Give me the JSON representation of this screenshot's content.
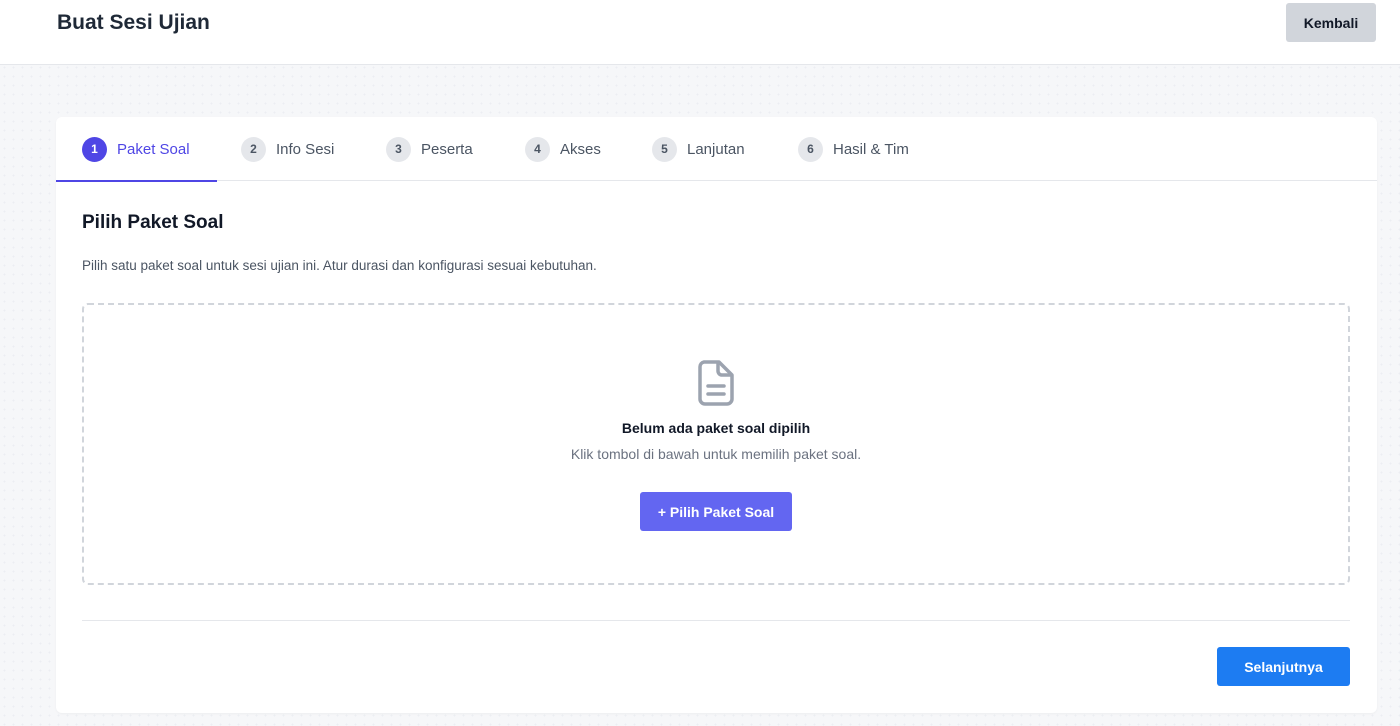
{
  "header": {
    "title": "Buat Sesi Ujian",
    "back_label": "Kembali"
  },
  "tabs": [
    {
      "number": "1",
      "label": "Paket Soal",
      "active": true
    },
    {
      "number": "2",
      "label": "Info Sesi",
      "active": false
    },
    {
      "number": "3",
      "label": "Peserta",
      "active": false
    },
    {
      "number": "4",
      "label": "Akses",
      "active": false
    },
    {
      "number": "5",
      "label": "Lanjutan",
      "active": false
    },
    {
      "number": "6",
      "label": "Hasil & Tim",
      "active": false
    }
  ],
  "section": {
    "title": "Pilih Paket Soal",
    "description": "Pilih satu paket soal untuk sesi ujian ini. Atur durasi dan konfigurasi sesuai kebutuhan."
  },
  "empty_state": {
    "icon": "document-icon",
    "title": "Belum ada paket soal dipilih",
    "subtitle": "Klik tombol di bawah untuk memilih paket soal.",
    "button_label": "+ Pilih Paket Soal"
  },
  "footer": {
    "next_label": "Selanjutnya"
  },
  "colors": {
    "accent": "#4f46e5",
    "pick_button": "#6366f1",
    "next_button": "#1d7cf2",
    "back_button": "#d1d5db"
  }
}
